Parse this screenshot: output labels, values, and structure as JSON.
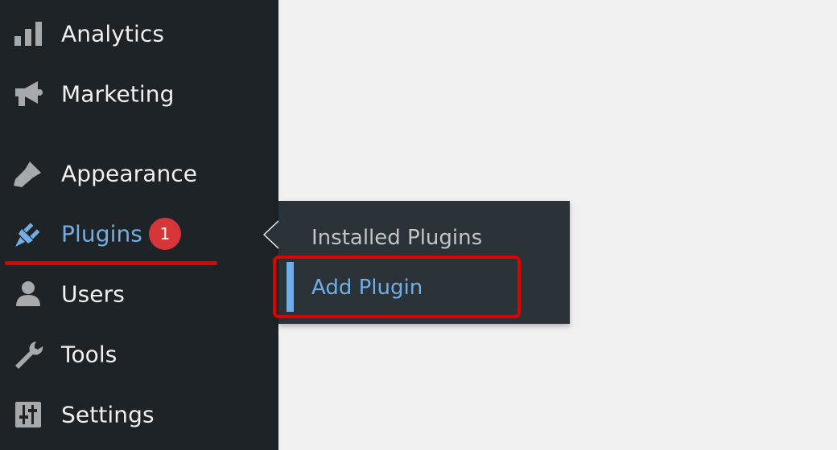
{
  "sidebar": {
    "items": [
      {
        "label": "Analytics",
        "icon": "bar-chart-icon"
      },
      {
        "label": "Marketing",
        "icon": "megaphone-icon"
      },
      {
        "label": "Appearance",
        "icon": "paintbrush-icon"
      },
      {
        "label": "Plugins",
        "icon": "plug-icon",
        "badge": "1",
        "current": true
      },
      {
        "label": "Users",
        "icon": "user-icon"
      },
      {
        "label": "Tools",
        "icon": "wrench-icon"
      },
      {
        "label": "Settings",
        "icon": "sliders-icon"
      }
    ]
  },
  "flyout": {
    "items": [
      {
        "label": "Installed Plugins"
      },
      {
        "label": "Add Plugin",
        "active": true
      }
    ]
  },
  "colors": {
    "sidebar_bg": "#1d2327",
    "flyout_bg": "#2c3338",
    "accent": "#72aee6",
    "badge": "#d63638",
    "annotation": "#e00000",
    "icon": "#a7aaad"
  }
}
